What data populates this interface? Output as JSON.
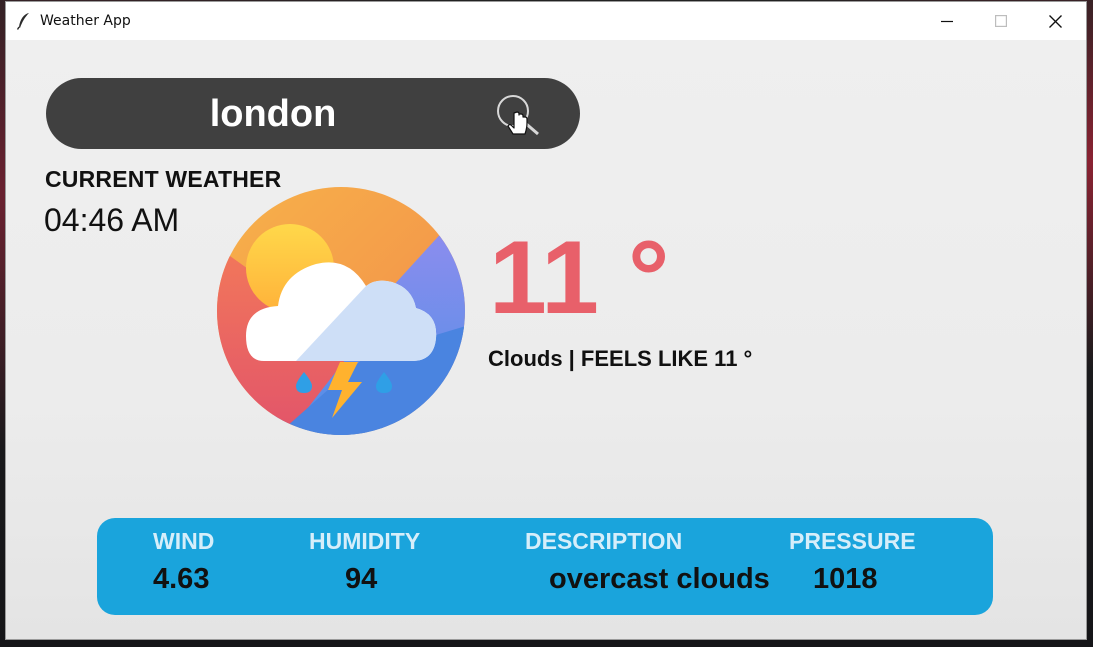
{
  "window": {
    "title": "Weather App",
    "controls": {
      "minimize_icon": "minimize-icon",
      "maximize_icon": "maximize-icon",
      "close_icon": "close-icon"
    }
  },
  "search": {
    "value": "london",
    "button_icon": "search-icon"
  },
  "current": {
    "section_title": "CURRENT WEATHER",
    "time": "04:46 AM",
    "icon": "cloud-thunder-rain-icon",
    "temperature": "11 °",
    "conditions": "Clouds | FEELS LIKE 11 °"
  },
  "details": {
    "wind_label": "WIND",
    "wind_value": "4.63",
    "humidity_label": "HUMIDITY",
    "humidity_value": "94",
    "description_label": "DESCRIPTION",
    "description_value": "overcast clouds",
    "pressure_label": "PRESSURE",
    "pressure_value": "1018"
  },
  "colors": {
    "search_bar": "#404040",
    "temperature": "#e8606a",
    "info_panel": "#1aa4dc",
    "info_label": "#d6eefa"
  }
}
